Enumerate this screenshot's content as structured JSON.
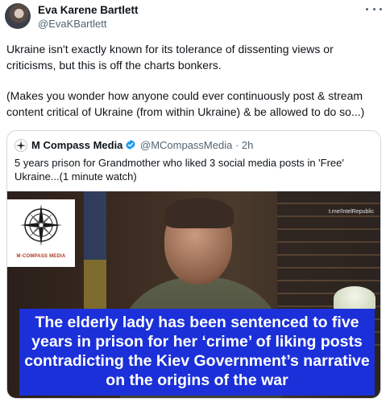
{
  "tweet": {
    "author_name": "Eva Karene Bartlett",
    "author_handle": "@EvaKBartlett",
    "text_paragraph_1": "Ukraine isn't exactly known for its tolerance of dissenting views or criticisms, but this is off the charts bonkers.",
    "text_paragraph_2": "(Makes you wonder how anyone could ever continuously post & stream content critical of Ukraine (from within Ukraine) & be allowed to do so...)"
  },
  "quote": {
    "author_name": "M Compass Media",
    "author_handle_time": "@MCompassMedia · 2h",
    "text": "5 years prison for Grandmother who liked 3 social media posts in 'Free' Ukraine...(1 minute watch)",
    "media": {
      "logo_text": "M-COMPASS MEDIA",
      "watermark": "t.me/IntelRepublic",
      "caption": "The elderly lady has been sentenced to five years in prison for her ‘crime’ of liking posts contradicting the Kiev Government’s narrative on the origins of the war"
    }
  },
  "colors": {
    "verified": "#1d9bf0",
    "caption_bg": "#1b30d8"
  },
  "icons": {
    "more": "more-icon",
    "verified": "verified-badge-icon",
    "compass": "compass-icon"
  }
}
